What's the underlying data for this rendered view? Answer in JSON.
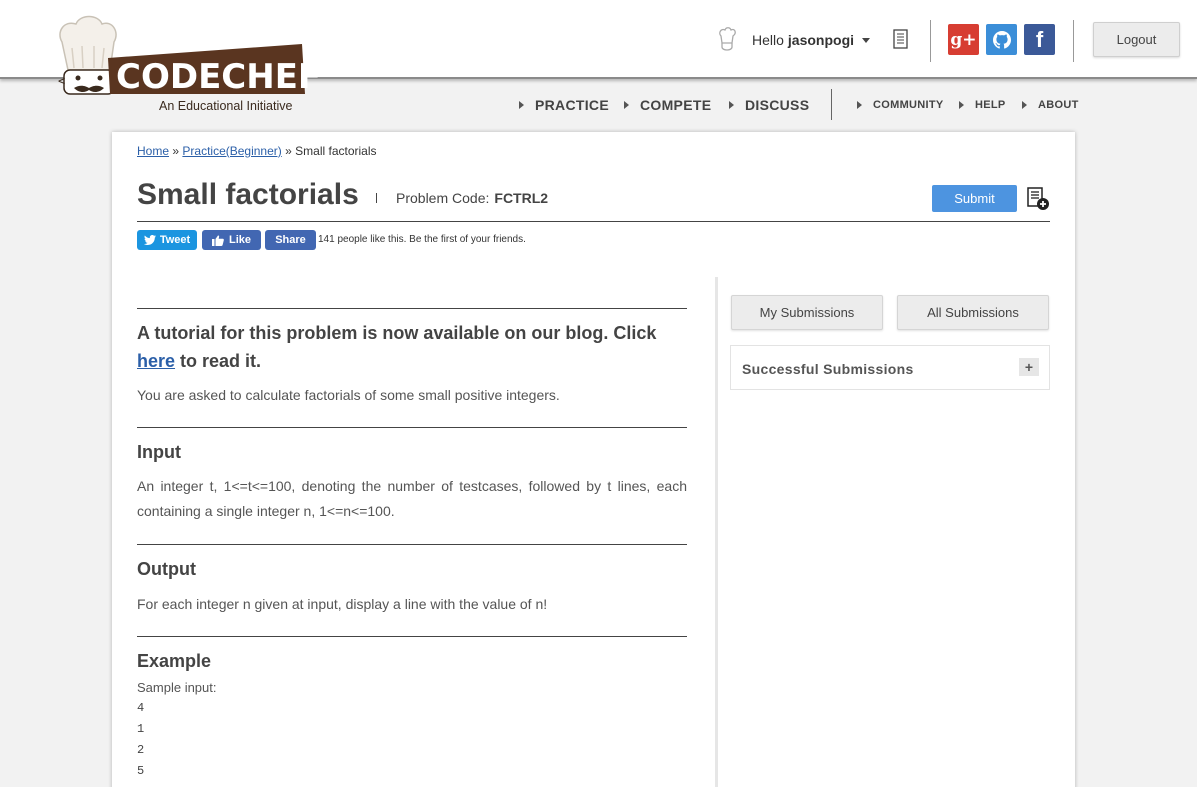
{
  "header": {
    "logo_text": "CODECHEF",
    "logo_tagline": "An Educational Initiative",
    "greeting": "Hello",
    "username": "jasonpogi",
    "logout_label": "Logout",
    "social": {
      "gplus": "g+",
      "facebook": "f"
    }
  },
  "nav": {
    "main": [
      "PRACTICE",
      "COMPETE",
      "DISCUSS"
    ],
    "secondary": [
      "COMMUNITY",
      "HELP",
      "ABOUT"
    ]
  },
  "breadcrumb": {
    "home": "Home",
    "sep1": "»",
    "practice": "Practice(Beginner)",
    "sep2": "»",
    "current": "Small factorials"
  },
  "problem": {
    "title": "Small factorials",
    "code_label": "Problem Code:",
    "code": "FCTRL2",
    "submit_label": "Submit"
  },
  "share": {
    "tweet_label": "Tweet",
    "like_label": "Like",
    "share_label": "Share",
    "like_count_text": "141 people like this. Be the first of your friends."
  },
  "statement": {
    "notice_prefix": "A tutorial for this problem is now available on our blog. Click ",
    "notice_link": "here",
    "notice_suffix": " to read it.",
    "intro": "You are asked to calculate factorials of some small positive integers.",
    "input_heading": "Input",
    "input_text": "An integer t, 1<=t<=100, denoting the number of testcases, followed by t lines, each containing a single integer n, 1<=n<=100.",
    "output_heading": "Output",
    "output_text": "For each integer n given at input, display a line with the value of n!",
    "example_heading": "Example",
    "sample_label": "Sample input:",
    "sample_lines": [
      "4",
      "1",
      "2",
      "5"
    ]
  },
  "sidebar": {
    "my_submissions": "My Submissions",
    "all_submissions": "All Submissions",
    "successful_title": "Successful Submissions",
    "expand_label": "+"
  },
  "colors": {
    "accent": "#4d94e0",
    "link": "#2b5fa8",
    "logo_brown": "#5a3520",
    "gplus": "#d73d32",
    "github": "#3b8ed8",
    "facebook": "#3b5998"
  }
}
